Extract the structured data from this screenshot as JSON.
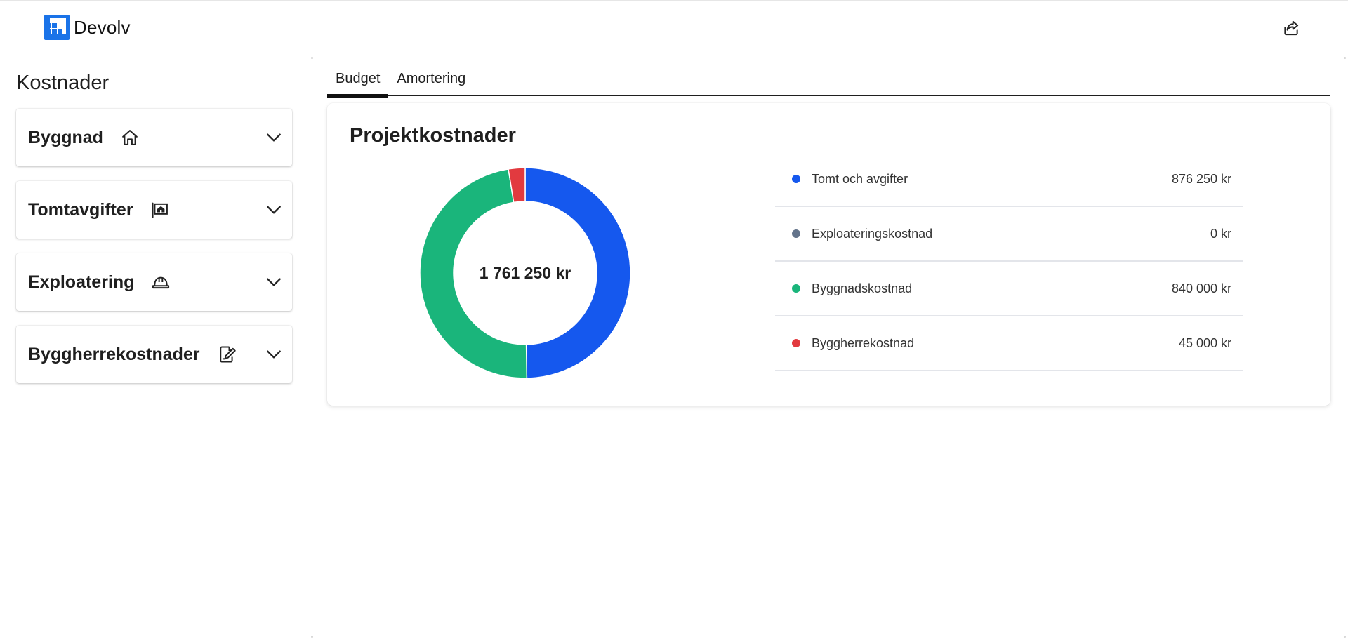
{
  "app": {
    "name": "Devolv",
    "brand_color": "#1a73e8"
  },
  "header": {
    "share_icon": "share-icon"
  },
  "sidebar": {
    "title": "Kostnader",
    "items": [
      {
        "label": "Byggnad",
        "icon": "house-icon"
      },
      {
        "label": "Tomtavgifter",
        "icon": "plot-sign-icon"
      },
      {
        "label": "Exploatering",
        "icon": "hardhat-icon"
      },
      {
        "label": "Byggherrekostnader",
        "icon": "edit-document-icon"
      }
    ]
  },
  "main": {
    "tabs": [
      {
        "label": "Budget",
        "active": true
      },
      {
        "label": "Amortering",
        "active": false
      }
    ],
    "card": {
      "title": "Projektkostnader",
      "total_label": "1 761 250 kr"
    }
  },
  "chart_data": {
    "type": "pie",
    "variant": "donut",
    "center_label": "1 761 250 kr",
    "categories": [
      "Tomt och avgifter",
      "Exploateringskostnad",
      "Byggnadskostnad",
      "Byggherrekostnad"
    ],
    "values": [
      876250,
      0,
      840000,
      45000
    ],
    "value_labels": [
      "876 250 kr",
      "0 kr",
      "840 000 kr",
      "45 000 kr"
    ],
    "colors": [
      "#1558ee",
      "#64748b",
      "#1ab57b",
      "#e23a3f"
    ],
    "legend_position": "right"
  }
}
